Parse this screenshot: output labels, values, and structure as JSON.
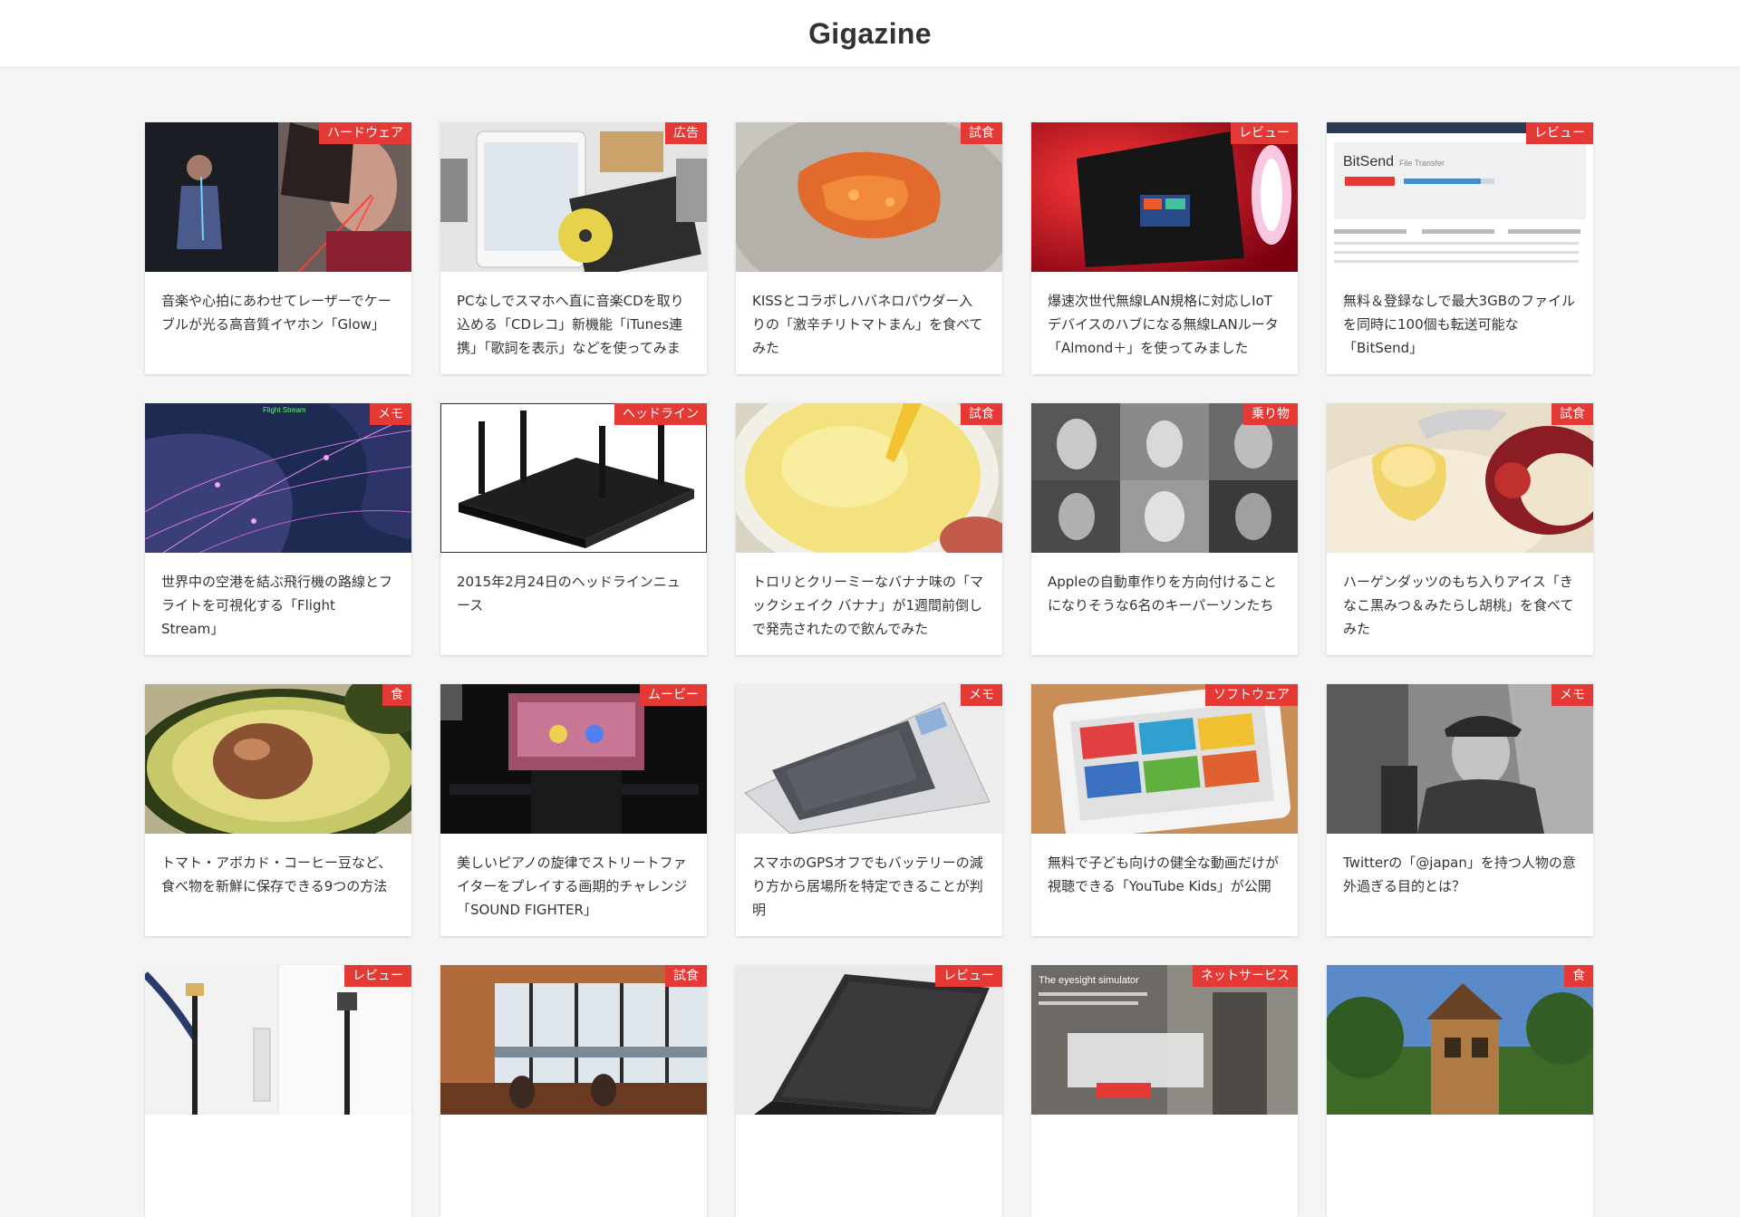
{
  "site": {
    "title": "Gigazine"
  },
  "articles": [
    {
      "category": "ハードウェア",
      "title": "音楽や心拍にあわせてレーザーでケーブルが光る高音質イヤホン「Glow」"
    },
    {
      "category": "広告",
      "title": "PCなしでスマホへ直に音楽CDを取り込める「CDレコ」新機能「iTunes連携」「歌詞を表示」などを使ってみま"
    },
    {
      "category": "試食",
      "title": "KISSとコラボしハバネロパウダー入りの「激辛チリトマトまん」を食べてみた"
    },
    {
      "category": "レビュー",
      "title": "爆速次世代無線LAN規格に対応しIoTデバイスのハブになる無線LANルータ「Almond＋」を使ってみました"
    },
    {
      "category": "レビュー",
      "title": "無料＆登録なしで最大3GBのファイルを同時に100個も転送可能な「BitSend」"
    },
    {
      "category": "メモ",
      "title": "世界中の空港を結ぶ飛行機の路線とフライトを可視化する「Flight Stream」"
    },
    {
      "category": "ヘッドライン",
      "title": "2015年2月24日のヘッドラインニュース"
    },
    {
      "category": "試食",
      "title": "トロリとクリーミーなバナナ味の「マックシェイク バナナ」が1週間前倒しで発売されたので飲んでみた"
    },
    {
      "category": "乗り物",
      "title": "Appleの自動車作りを方向付けることになりそうな6名のキーパーソンたち"
    },
    {
      "category": "試食",
      "title": "ハーゲンダッツのもち入りアイス「きなこ黒みつ＆みたらし胡桃」を食べてみた"
    },
    {
      "category": "食",
      "title": "トマト・アボカド・コーヒー豆など、食べ物を新鮮に保存できる9つの方法"
    },
    {
      "category": "ムービー",
      "title": "美しいピアノの旋律でストリートファイターをプレイする画期的チャレンジ「SOUND FIGHTER」"
    },
    {
      "category": "メモ",
      "title": "スマホのGPSオフでもバッテリーの減り方から居場所を特定できることが判明"
    },
    {
      "category": "ソフトウェア",
      "title": "無料で子ども向けの健全な動画だけが視聴できる「YouTube Kids」が公開"
    },
    {
      "category": "メモ",
      "title": "Twitterの「@japan」を持つ人物の意外過ぎる目的とは？"
    },
    {
      "category": "レビュー",
      "title": ""
    },
    {
      "category": "試食",
      "title": ""
    },
    {
      "category": "レビュー",
      "title": ""
    },
    {
      "category": "ネットサービス",
      "title": ""
    },
    {
      "category": "食",
      "title": ""
    }
  ],
  "thumbnail_text": {
    "bitsend_brand": "BitSend",
    "bitsend_sub": "File Transfer",
    "flight_stream_label": "Flight Stream",
    "eyesight_heading": "The eyesight simulator"
  },
  "colors": {
    "badge": "#e53935",
    "page_bg": "#f4f4f4"
  }
}
